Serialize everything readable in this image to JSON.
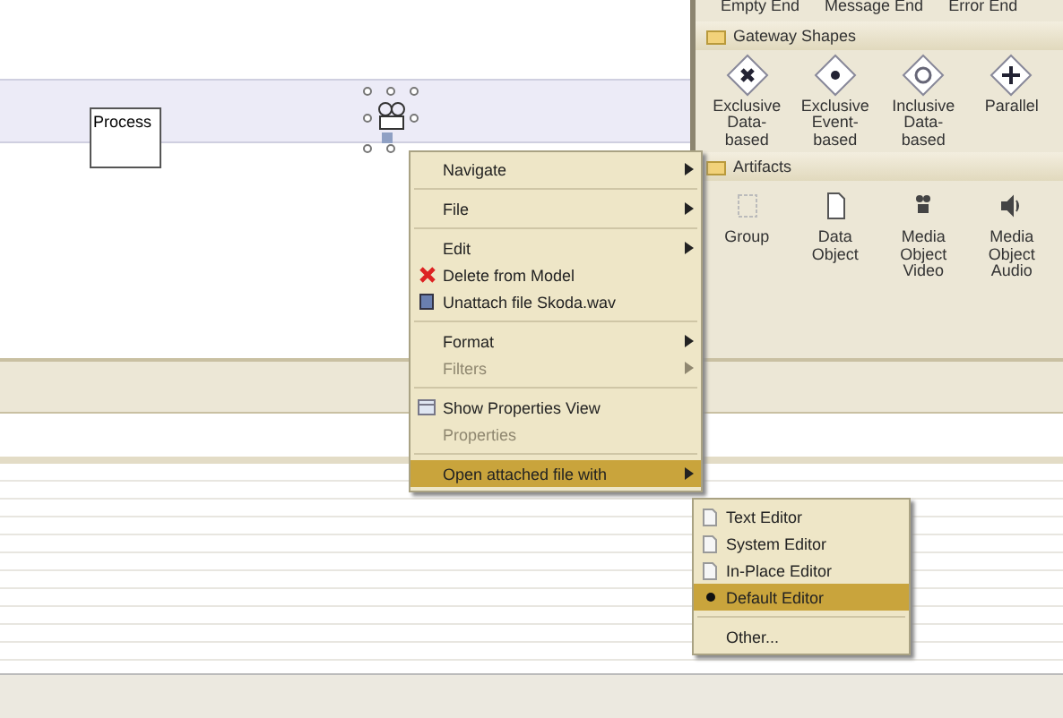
{
  "canvas": {
    "nodes": [
      {
        "label": "Process",
        "kind": "task"
      },
      {
        "kind": "media",
        "selected": true
      }
    ]
  },
  "palette": {
    "top_labels": [
      "Empty End",
      "Message End",
      "Error End"
    ],
    "sections": [
      {
        "title": "Gateway Shapes",
        "items": [
          {
            "label": "Exclusive\nData-\nbased",
            "kind": "x"
          },
          {
            "label": "Exclusive\nEvent-\nbased",
            "kind": "dot"
          },
          {
            "label": "Inclusive\nData-\nbased",
            "kind": "circle"
          },
          {
            "label": "Parallel",
            "kind": "plus"
          }
        ]
      },
      {
        "title": "Artifacts",
        "items": [
          {
            "label": "Group",
            "kind": "group"
          },
          {
            "label": "Data\nObject",
            "kind": "doc"
          },
          {
            "label": "Media\nObject\nVideo",
            "kind": "video"
          },
          {
            "label": "Media\nObject\nAudio",
            "kind": "audio"
          }
        ]
      }
    ]
  },
  "context_menu": {
    "items": [
      {
        "kind": "item",
        "label": "Navigate",
        "submenu": true,
        "disabled": false,
        "selected": false
      },
      {
        "kind": "separator"
      },
      {
        "kind": "item",
        "label": "File",
        "submenu": true,
        "disabled": false,
        "selected": false
      },
      {
        "kind": "separator"
      },
      {
        "kind": "item",
        "label": "Edit",
        "submenu": true,
        "disabled": false,
        "selected": false
      },
      {
        "kind": "delete",
        "label": "Delete from Model",
        "disabled": false,
        "selected": false
      },
      {
        "kind": "unattach",
        "label": "Unattach file Skoda.wav",
        "disabled": false,
        "selected": false
      },
      {
        "kind": "separator"
      },
      {
        "kind": "item",
        "label": "Format",
        "submenu": true,
        "disabled": false,
        "selected": false
      },
      {
        "kind": "item",
        "label": "Filters",
        "submenu": true,
        "disabled": true,
        "selected": false
      },
      {
        "kind": "separator"
      },
      {
        "kind": "properties",
        "label": "Show Properties View",
        "disabled": false,
        "selected": false
      },
      {
        "kind": "item",
        "label": "Properties",
        "disabled": true,
        "selected": false
      },
      {
        "kind": "separator"
      },
      {
        "kind": "item",
        "label": "Open attached file with",
        "submenu": true,
        "disabled": false,
        "selected": true
      }
    ]
  },
  "submenu": {
    "items": [
      {
        "kind": "file",
        "label": "Text Editor",
        "selected": false,
        "checked": false
      },
      {
        "kind": "file",
        "label": "System Editor",
        "selected": false,
        "checked": false
      },
      {
        "kind": "file",
        "label": "In-Place Editor",
        "selected": false,
        "checked": false
      },
      {
        "kind": "item",
        "label": "Default Editor",
        "selected": true,
        "checked": true
      },
      {
        "kind": "separator"
      },
      {
        "kind": "item",
        "label": "Other...",
        "selected": false,
        "checked": false
      }
    ]
  }
}
